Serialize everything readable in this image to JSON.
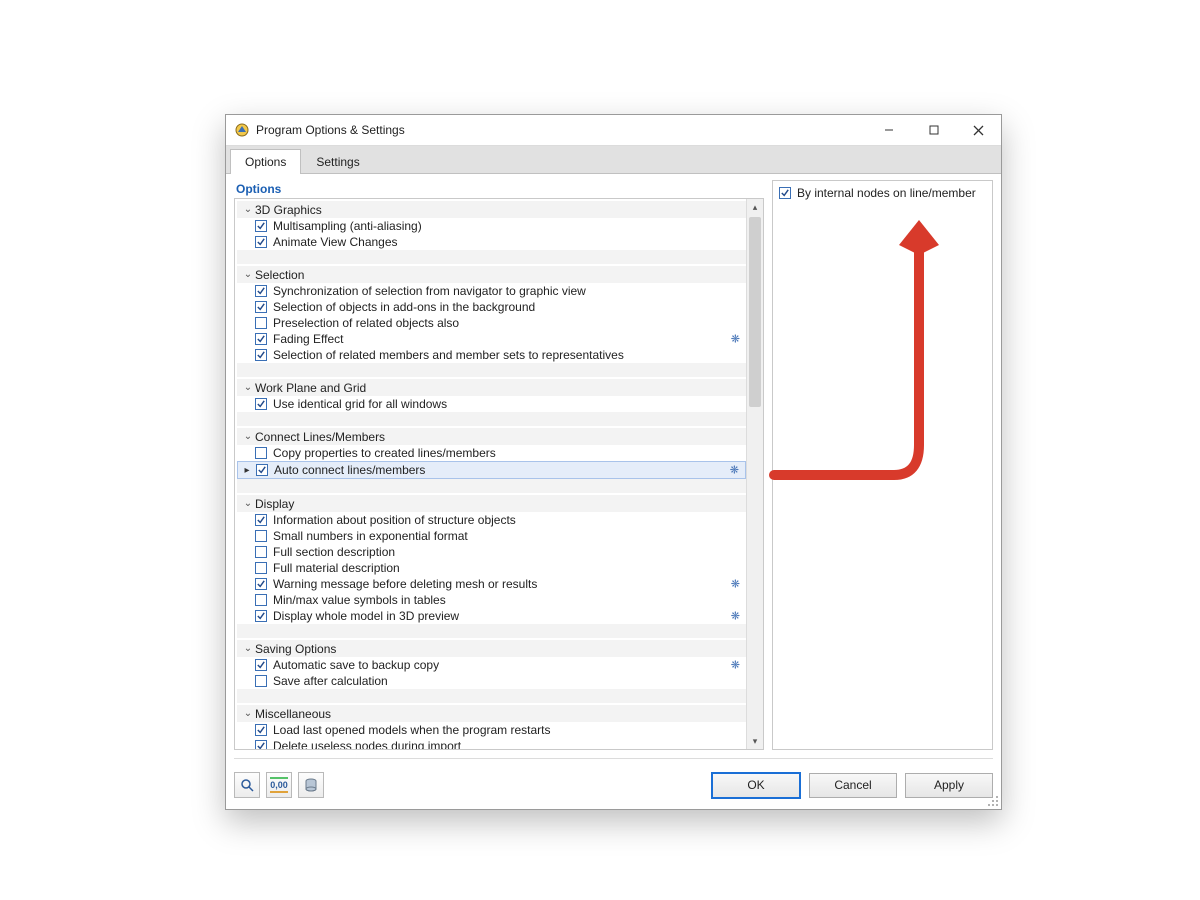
{
  "window": {
    "title": "Program Options & Settings"
  },
  "tabs": {
    "options": "Options",
    "settings": "Settings"
  },
  "left_title": "Options",
  "groups": [
    {
      "label": "3D Graphics",
      "items": [
        {
          "label": "Multisampling (anti-aliasing)",
          "checked": true
        },
        {
          "label": "Animate View Changes",
          "checked": true
        }
      ]
    },
    {
      "label": "Selection",
      "items": [
        {
          "label": "Synchronization of selection from navigator to graphic view",
          "checked": true
        },
        {
          "label": "Selection of objects in add-ons in the background",
          "checked": true
        },
        {
          "label": "Preselection of related objects also",
          "checked": false
        },
        {
          "label": "Fading Effect",
          "checked": true,
          "gear": true
        },
        {
          "label": "Selection of related members and member sets to representatives",
          "checked": true
        }
      ]
    },
    {
      "label": "Work Plane and Grid",
      "items": [
        {
          "label": "Use identical grid for all windows",
          "checked": true
        }
      ]
    },
    {
      "label": "Connect Lines/Members",
      "items": [
        {
          "label": "Copy properties to created lines/members",
          "checked": false
        },
        {
          "label": "Auto connect lines/members",
          "checked": true,
          "gear": true,
          "selected": true,
          "caret": true
        }
      ]
    },
    {
      "label": "Display",
      "items": [
        {
          "label": "Information about position of structure objects",
          "checked": true
        },
        {
          "label": "Small numbers in exponential format",
          "checked": false
        },
        {
          "label": "Full section description",
          "checked": false
        },
        {
          "label": "Full material description",
          "checked": false
        },
        {
          "label": "Warning message before deleting mesh or results",
          "checked": true,
          "gear": true
        },
        {
          "label": "Min/max value symbols in tables",
          "checked": false
        },
        {
          "label": "Display whole model in 3D preview",
          "checked": true,
          "gear": true
        }
      ]
    },
    {
      "label": "Saving Options",
      "items": [
        {
          "label": "Automatic save to backup copy",
          "checked": true,
          "gear": true
        },
        {
          "label": "Save after calculation",
          "checked": false
        }
      ]
    },
    {
      "label": "Miscellaneous",
      "items": [
        {
          "label": "Load last opened models when the program restarts",
          "checked": true
        },
        {
          "label": "Delete useless nodes during import",
          "checked": true
        }
      ]
    }
  ],
  "detail": {
    "by_internal_nodes": {
      "label": "By internal nodes on line/member",
      "checked": true
    }
  },
  "footer": {
    "decimal_label": "0,00",
    "ok": "OK",
    "cancel": "Cancel",
    "apply": "Apply"
  },
  "colors": {
    "arrow": "#d83a2b"
  }
}
